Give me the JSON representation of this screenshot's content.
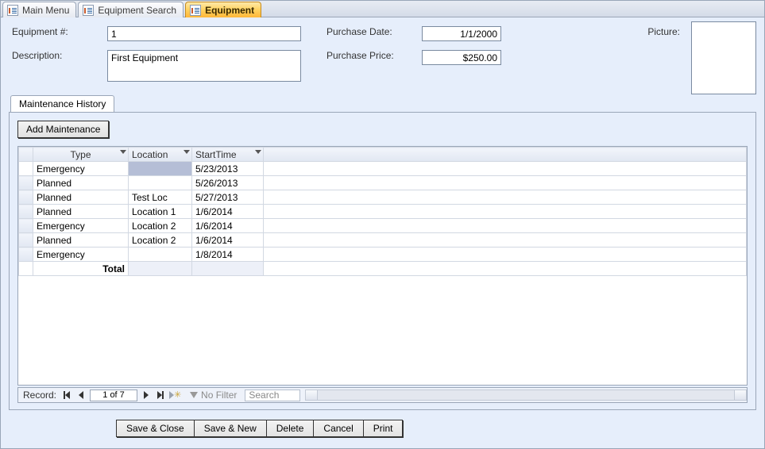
{
  "tabs": [
    {
      "label": "Main Menu",
      "active": false
    },
    {
      "label": "Equipment Search",
      "active": false
    },
    {
      "label": "Equipment",
      "active": true
    }
  ],
  "form": {
    "equipment_no_label": "Equipment #:",
    "equipment_no": "1",
    "description_label": "Description:",
    "description": "First Equipment",
    "purchase_date_label": "Purchase Date:",
    "purchase_date": "1/1/2000",
    "purchase_price_label": "Purchase Price:",
    "purchase_price": "$250.00",
    "picture_label": "Picture:"
  },
  "subtab": {
    "title": "Maintenance History",
    "add_btn": "Add Maintenance",
    "cols": {
      "type": "Type",
      "location": "Location",
      "start": "StartTime"
    },
    "rows": [
      {
        "type": "Emergency",
        "location": "",
        "start": "5/23/2013",
        "active": true
      },
      {
        "type": "Planned",
        "location": "",
        "start": "5/26/2013"
      },
      {
        "type": "Planned",
        "location": "Test Loc",
        "start": "5/27/2013"
      },
      {
        "type": "Planned",
        "location": "Location 1",
        "start": "1/6/2014"
      },
      {
        "type": "Emergency",
        "location": "Location 2",
        "start": "1/6/2014"
      },
      {
        "type": "Planned",
        "location": "Location 2",
        "start": "1/6/2014"
      },
      {
        "type": "Emergency",
        "location": "",
        "start": "1/8/2014"
      }
    ],
    "total_label": "Total",
    "nav": {
      "record_label": "Record:",
      "position": "1 of 7",
      "filter": "No Filter",
      "search": "Search"
    }
  },
  "buttons": {
    "save_close": "Save & Close",
    "save_new": "Save & New",
    "delete": "Delete",
    "cancel": "Cancel",
    "print": "Print"
  }
}
